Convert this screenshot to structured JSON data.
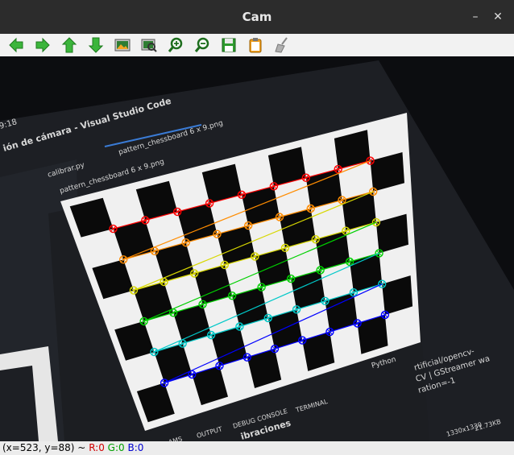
{
  "window": {
    "title": "Cam"
  },
  "toolbar": {
    "buttons": [
      {
        "icon": "arrow-left-icon"
      },
      {
        "icon": "arrow-right-icon"
      },
      {
        "icon": "arrow-up-icon"
      },
      {
        "icon": "arrow-down-icon"
      },
      {
        "icon": "image-icon"
      },
      {
        "icon": "image-zoom-icon"
      },
      {
        "icon": "zoom-in-icon"
      },
      {
        "icon": "zoom-out-icon"
      },
      {
        "icon": "save-icon"
      },
      {
        "icon": "clipboard-icon"
      },
      {
        "icon": "broom-icon"
      }
    ]
  },
  "screen": {
    "clock": "9:18",
    "vscode_title": "ión de cámara - Visual Studio Code",
    "tab_calibrar": "calibrar.py",
    "tab_active": "pattern_chessboard 6 x 9.png",
    "breadcrumb": "pattern_chessboard 6 x 9.png",
    "panel_tabs": [
      "OUTPUT",
      "DEBUG CONSOLE",
      "TERMINAL"
    ],
    "panel_python": "Python",
    "terminal_lines": [
      "rtificial/opencv-",
      "CV | GStreamer wa",
      "ration=-1"
    ],
    "status_size": "1330x1330",
    "status_kb": "21.73KB",
    "vibraciones": "ibraciones",
    "doc_tab": "AMS"
  },
  "status": {
    "coords": "(x=523, y=88) ~",
    "r": "R:0",
    "g": "G:0",
    "b": "B:0"
  },
  "colors": {
    "row_colors": [
      "#ff0000",
      "#ff8c00",
      "#d7d700",
      "#00d000",
      "#00c8c8",
      "#0000ff"
    ]
  }
}
